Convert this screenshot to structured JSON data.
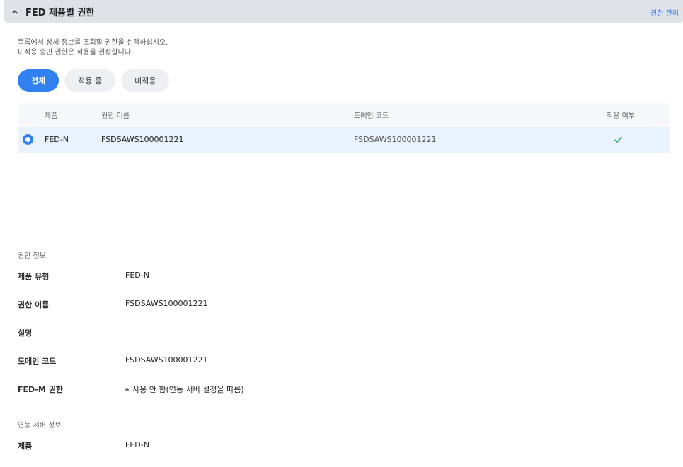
{
  "header": {
    "title": "FED 제품별 권한",
    "chevron_icon": "chevron-up-icon",
    "manage_link": "권한 관리"
  },
  "description": {
    "line1": "목록에서 상세 정보를 조회할 권한을 선택하십시오.",
    "line2": "미적용 중인 권한은 적용을 권장합니다."
  },
  "filters": [
    {
      "label": "전체",
      "selected": true
    },
    {
      "label": "적용 중",
      "selected": false
    },
    {
      "label": "미적용",
      "selected": false
    }
  ],
  "table": {
    "columns": [
      "제품",
      "권한 이름",
      "도메인 코드",
      "적용 여부"
    ],
    "rows": [
      {
        "product": "FED-N",
        "name": "FSDSAWS100001221",
        "domain_code": "FSDSAWS100001221",
        "applied": true,
        "selected": true
      }
    ]
  },
  "license_info": {
    "section_label": "권한 정보",
    "fields": [
      {
        "key": "제품 유형",
        "value": "FED-N"
      },
      {
        "key": "권한 이름",
        "value": "FSDSAWS100001221"
      },
      {
        "key": "설명",
        "value": ""
      },
      {
        "key": "도메인 코드",
        "value": "FSDSAWS100001221"
      },
      {
        "key": "FED-M 권한",
        "value": "사용 안 함(연동 서버 설정을 따름)"
      }
    ]
  },
  "server_info": {
    "section_label": "연동 서버 정보",
    "fields": [
      {
        "key": "제품",
        "value": "FED-N"
      }
    ]
  },
  "colors": {
    "accent": "#3080f0",
    "check": "#1fb56a",
    "selected_row": "#eaf3fd",
    "header_bg": "#dfe3e8"
  }
}
